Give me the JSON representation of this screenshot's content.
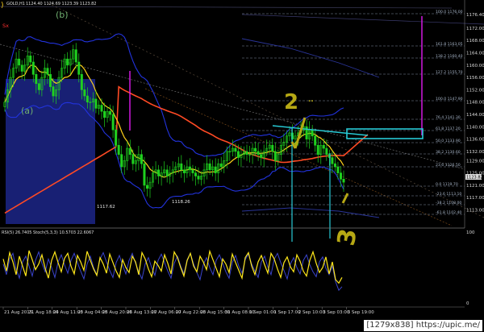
{
  "window": {
    "symbol_header": "GOLD,H1",
    "ohlc_header": "1124.40 1124.69 1123.39 1123.82",
    "close_marker": "Sx"
  },
  "wave_labels": [
    "(a)",
    "(b)"
  ],
  "level_labels": [
    "1117.62",
    "1118.26"
  ],
  "price_axis": {
    "ticks": [
      "1176.40",
      "1172.00",
      "1168.00",
      "1164.00",
      "1160.00",
      "1156.00",
      "1152.00",
      "1148.00",
      "1144.00",
      "1140.00",
      "1136.00",
      "1132.00",
      "1129.00",
      "1125.00",
      "1121.00",
      "1117.00",
      "1113.00"
    ],
    "current_price": "1123.82"
  },
  "fib_levels": [
    "100.0 1176.00",
    "161.8 1163.05",
    "138.2 1160.40",
    "127.2 1155.70",
    "100.0 1147.90",
    "76.4 1141.30",
    "61.8 1137.20",
    "50.0 1133.90",
    "38.2 1130.60",
    "23.6 1126.50",
    "0.0 1119.70",
    "-23.6 1113.10",
    "-38.2 1108.00",
    "-61.8 1102.40"
  ],
  "time_axis": [
    "21 Aug 2015",
    "21 Aug 18:00",
    "24 Aug 11:00",
    "25 Aug 04:00",
    "25 Aug 20:00",
    "26 Aug 13:00",
    "27 Aug 06:00",
    "27 Aug 22:00",
    "28 Aug 15:00",
    "31 Aug 08:00",
    "1 Sep 01:00",
    "1 Sep 17:00",
    "2 Sep 10:00",
    "3 Sep 03:00",
    "3 Sep 19:00"
  ],
  "oscillator": {
    "header": "RSI(5) 26.7405  Stoch(5,3,3) 10.5703 22.6067",
    "ticks": [
      "100",
      "0"
    ]
  },
  "annotations": {
    "wave_2": "2",
    "wave_3": "3"
  },
  "colors": {
    "background": "#000000",
    "bull_candle": "#1fd11f",
    "bear_candle": "#1fd11f",
    "fast_ma": "#ffd21a",
    "slow_ma": "#ff4a24",
    "bands": "#2233dd",
    "box_fill": "#1a237e",
    "cyan_markup": "#27c9d4",
    "magenta_markup": "#e01aef",
    "fib_line": "#8c9cb4"
  },
  "watermark": "[1279x838] https://upic.me/",
  "chart_data": {
    "type": "candlestick",
    "title": "GOLD,H1",
    "ylim": [
      1110,
      1178
    ],
    "series": [
      {
        "name": "GOLD,H1",
        "values": [
          1148,
          1152,
          1156,
          1159,
          1162,
          1160,
          1158,
          1160,
          1163,
          1161,
          1157,
          1154,
          1152,
          1156,
          1159,
          1157,
          1153,
          1150,
          1152,
          1156,
          1159,
          1162,
          1160,
          1162,
          1165,
          1161,
          1157,
          1152,
          1150,
          1148,
          1148,
          1149,
          1146,
          1147,
          1145,
          1143,
          1145,
          1144,
          1139,
          1134,
          1131,
          1127,
          1129,
          1133,
          1131,
          1128,
          1129,
          1131,
          1128,
          1121,
          1120,
          1122,
          1125,
          1126,
          1124,
          1125,
          1126,
          1124,
          1125,
          1126,
          1127,
          1128,
          1126,
          1125,
          1127,
          1126,
          1125,
          1124,
          1123,
          1124,
          1126,
          1128,
          1126,
          1127,
          1125,
          1128,
          1127,
          1129,
          1132,
          1132,
          1133,
          1132,
          1130,
          1131,
          1132,
          1131,
          1131,
          1133,
          1132,
          1131,
          1130,
          1132,
          1133,
          1134,
          1132,
          1129,
          1131,
          1134,
          1135,
          1137,
          1138,
          1136,
          1137,
          1138,
          1139,
          1140,
          1136,
          1139,
          1137,
          1134,
          1131,
          1134,
          1133,
          1131,
          1130,
          1128,
          1127,
          1125,
          1123,
          1122
        ]
      },
      {
        "name": "RSI(5)",
        "values": [
          62,
          45,
          71,
          58,
          40,
          66,
          52,
          38,
          74,
          61,
          47,
          55,
          68,
          49,
          35,
          60,
          72,
          57,
          44,
          63,
          70,
          52,
          41,
          67,
          58,
          46,
          73,
          60,
          48,
          39,
          64,
          55,
          42,
          69,
          57,
          45,
          36,
          61,
          50,
          43,
          66,
          58,
          40,
          71,
          62,
          48,
          37,
          59,
          53,
          45,
          68,
          56,
          41,
          72,
          64,
          50,
          38,
          60,
          70,
          52,
          44,
          66,
          58,
          47,
          73,
          61,
          49,
          37,
          62,
          55,
          43,
          69,
          57,
          46,
          35,
          64,
          71,
          52,
          40,
          58,
          67,
          54,
          42,
          70,
          62,
          48,
          36,
          57,
          65,
          51,
          44,
          68,
          59,
          45,
          38,
          60,
          72,
          56,
          43,
          50,
          65,
          41,
          58,
          33,
          28,
          36
        ]
      },
      {
        "name": "Stoch(5,3,3)",
        "values": [
          55,
          40,
          62,
          70,
          48,
          35,
          58,
          66,
          52,
          38,
          60,
          72,
          56,
          44,
          62,
          50,
          36,
          58,
          68,
          54,
          42,
          60,
          70,
          57,
          45,
          34,
          55,
          66,
          50,
          40,
          62,
          71,
          58,
          46,
          36,
          57,
          67,
          53,
          41,
          60,
          70,
          56,
          44,
          34,
          55,
          64,
          50,
          39,
          60,
          69,
          57,
          45,
          35,
          56,
          66,
          52,
          41,
          61,
          70,
          55,
          43,
          33,
          54,
          64,
          50,
          40,
          60,
          68,
          56,
          44,
          35,
          57,
          67,
          52,
          42,
          61,
          69,
          55,
          45,
          36,
          58,
          66,
          51,
          40,
          62,
          70,
          57,
          46,
          34,
          55,
          64,
          50,
          41,
          60,
          68,
          54,
          44,
          37,
          58,
          65,
          49,
          40,
          52,
          30,
          18,
          23
        ]
      }
    ]
  }
}
